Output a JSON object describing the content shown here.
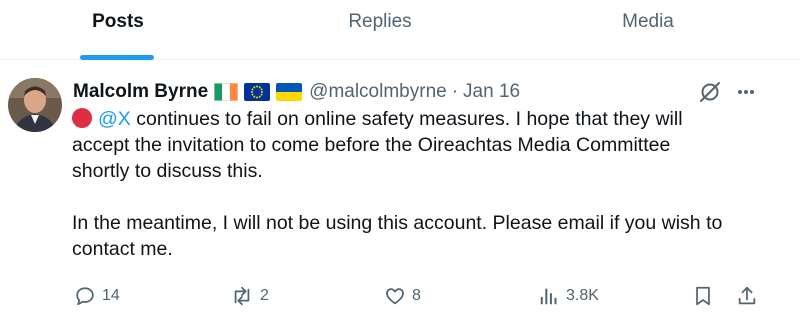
{
  "tabs": [
    {
      "label": "Posts",
      "active": true
    },
    {
      "label": "Replies",
      "active": false
    },
    {
      "label": "Media",
      "active": false
    }
  ],
  "post": {
    "author": {
      "display_name": "Malcolm Byrne",
      "handle": "@malcolmbyrne",
      "flags": [
        "ireland-flag-icon",
        "eu-flag-icon",
        "ukraine-flag-icon"
      ]
    },
    "separator": "·",
    "date": "Jan 16",
    "text": {
      "line1_mention": "@X",
      "line1_rest": " continues to fail on online safety measures.  I hope that they will",
      "line2": "accept the invitation to come before the Oireachtas Media Committee",
      "line3": "shortly to discuss this.",
      "line5": "In the meantime, I will not be using this account. Please email if you wish to",
      "line6": "contact me."
    },
    "stats": {
      "replies": "14",
      "reposts": "2",
      "likes": "8",
      "views": "3.8K"
    }
  },
  "colors": {
    "accent": "#1d9bf0",
    "text": "#0f1419",
    "muted": "#536471",
    "red_circle": "#dd2e44"
  }
}
